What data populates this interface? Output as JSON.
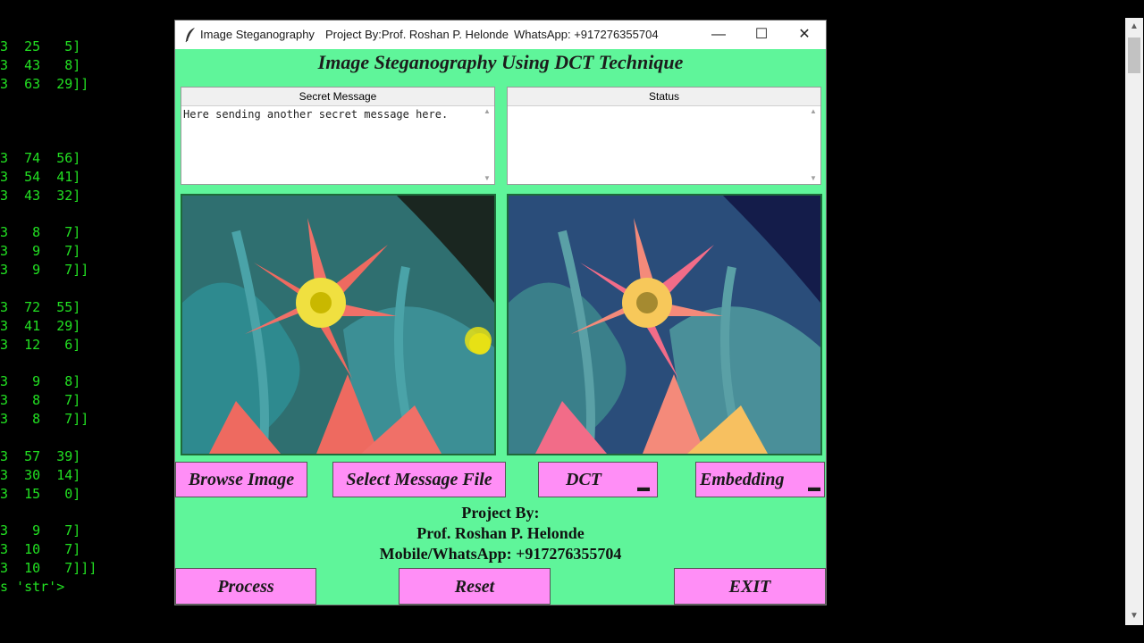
{
  "console_lines": [
    "3  25   5]",
    "3  43   8]",
    "3  63  29]]",
    "3  74  56]",
    "3  54  41]",
    "3  43  32]",
    "3   8   7]",
    "3   9   7]",
    "3   9   7]]",
    "3  72  55]",
    "3  41  29]",
    "3  12   6]",
    "3   9   8]",
    "3   8   7]",
    "3   8   7]]",
    "3  57  39]",
    "3  30  14]",
    "3  15   0]",
    "3   9   7]",
    "3  10   7]",
    "3  10   7]]]",
    "s 'str'>"
  ],
  "window": {
    "title": "Image Steganography",
    "project_by": "Project By:Prof. Roshan P. Helonde",
    "whatsapp": "WhatsApp: +917276355704",
    "minimize": "—",
    "maximize": "☐",
    "close": "✕"
  },
  "heading": "Image Steganography Using DCT Technique",
  "secret_message": {
    "label": "Secret Message",
    "text": "Here sending another secret message here."
  },
  "status": {
    "label": "Status",
    "text": ""
  },
  "buttons": {
    "browse": "Browse Image",
    "select_message": "Select Message File",
    "method": "DCT",
    "mode": "Embedding",
    "process": "Process",
    "reset": "Reset",
    "exit": "EXIT"
  },
  "credits": {
    "line1": "Project By:",
    "line2": "Prof. Roshan P. Helonde",
    "line3": "Mobile/WhatsApp: +917276355704"
  },
  "colors": {
    "window_bg": "#5ff59a",
    "button_bg": "#ff8ef6",
    "console_text": "#22e022"
  },
  "icons": {
    "app": "feather-icon",
    "scroll_up": "chevron-up-icon",
    "scroll_down": "chevron-down-icon",
    "dropdown": "option-menu-indicator-icon"
  }
}
